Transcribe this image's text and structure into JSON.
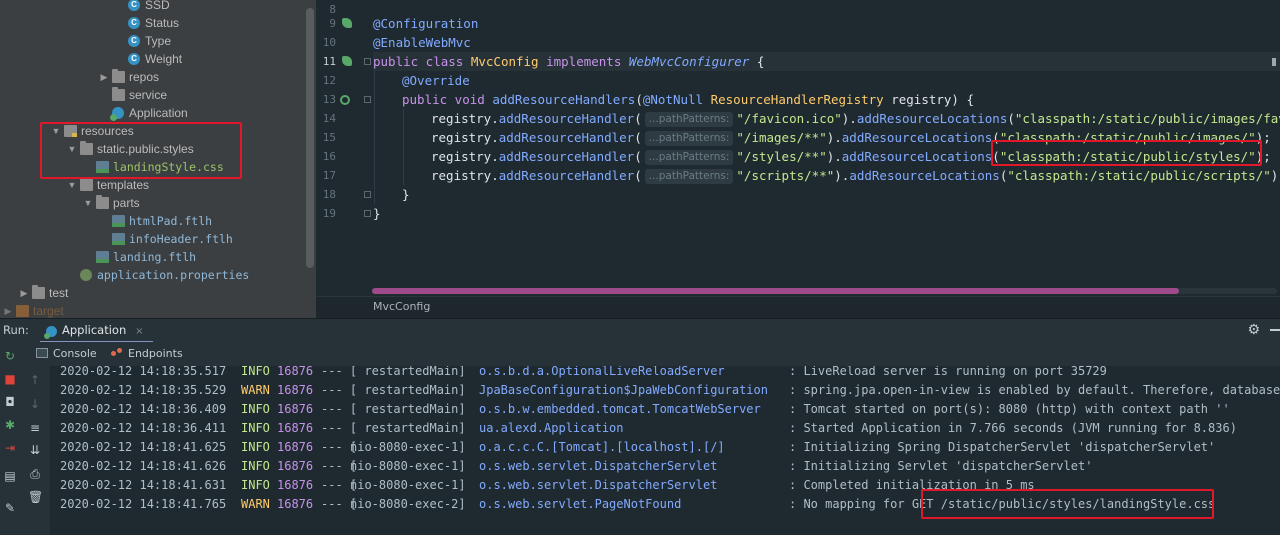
{
  "tree": {
    "items": [
      {
        "label": "SSD",
        "icon": "class-icon",
        "depth": 7,
        "arrow": ""
      },
      {
        "label": "Status",
        "icon": "class-icon",
        "depth": 7,
        "arrow": ""
      },
      {
        "label": "Type",
        "icon": "class-icon",
        "depth": 7,
        "arrow": ""
      },
      {
        "label": "Weight",
        "icon": "class-icon",
        "depth": 7,
        "arrow": ""
      },
      {
        "label": "repos",
        "icon": "folder-icon",
        "depth": 6,
        "arrow": "right"
      },
      {
        "label": "service",
        "icon": "folder-icon",
        "depth": 6,
        "arrow": ""
      },
      {
        "label": "Application",
        "icon": "spring-app-icon",
        "depth": 6,
        "arrow": ""
      },
      {
        "label": "resources",
        "icon": "resources-folder-icon",
        "depth": 3,
        "arrow": "down"
      },
      {
        "label": "static.public.styles",
        "icon": "folder-icon",
        "depth": 4,
        "arrow": "down"
      },
      {
        "label": "landingStyle.css",
        "icon": "css-file-icon",
        "depth": 5,
        "arrow": "",
        "file": true
      },
      {
        "label": "templates",
        "icon": "folder-icon",
        "depth": 4,
        "arrow": "down"
      },
      {
        "label": "parts",
        "icon": "folder-icon",
        "depth": 5,
        "arrow": "down"
      },
      {
        "label": "htmlPad.ftlh",
        "icon": "ftl-file-icon",
        "depth": 6,
        "arrow": "",
        "file": true
      },
      {
        "label": "infoHeader.ftlh",
        "icon": "ftl-file-icon",
        "depth": 6,
        "arrow": "",
        "file": true
      },
      {
        "label": "landing.ftlh",
        "icon": "ftl-file-icon",
        "depth": 5,
        "arrow": "",
        "file": true
      },
      {
        "label": "application.properties",
        "icon": "properties-file-icon",
        "depth": 4,
        "arrow": "",
        "file": true
      },
      {
        "label": "test",
        "icon": "folder-icon",
        "depth": 1,
        "arrow": "right"
      },
      {
        "label": "target",
        "icon": "target-folder-icon",
        "depth": 0,
        "arrow": "right",
        "muted": true
      }
    ]
  },
  "editor": {
    "line_numbers": [
      "8",
      "9",
      "10",
      "11",
      "12",
      "13",
      "14",
      "15",
      "16",
      "17",
      "18",
      "19"
    ],
    "current_line": "11",
    "code": {
      "l9_annotation": "@Configuration",
      "l10_annotation": "@EnableWebMvc",
      "l11_kw1": "public class ",
      "l11_class": "MvcConfig",
      "l11_kw2": " implements ",
      "l11_iface": "WebMvcConfigurer",
      "l11_brace": " {",
      "l12_annotation": "@Override",
      "l13_kw": "public void ",
      "l13_method": "addResourceHandlers",
      "l13_paren": "(",
      "l13_ann": "@NotNull",
      "l13_type": " ResourceHandlerRegistry",
      "l13_param": " registry) {",
      "registry": "registry.",
      "add_handler": "addResourceHandler",
      "add_locations": "addResourceLocations",
      "hint": "...pathPatterns:",
      "l14_pattern": "\"/favicon.ico\"",
      "l14_location": "\"classpath:/static/public/images/favi",
      "l15_pattern": "\"/images/**\"",
      "l15_location": "\"classpath:/static/public/images/\"",
      "l16_pattern": "\"/styles/**\"",
      "l16_location": "\"classpath:/static/public/styles/\"",
      "l17_pattern": "\"/scripts/**\"",
      "l17_location": "\"classpath:/static/public/scripts/\"",
      "close_paren": ").",
      "paren_open": "(",
      "end_stmt": ");",
      "l18_brace": "}",
      "l19_brace": "}"
    },
    "breadcrumb": "MvcConfig"
  },
  "run": {
    "label": "Run:",
    "tab": "Application",
    "tab_close": "×",
    "subtabs": {
      "console": "Console",
      "endpoints": "Endpoints"
    },
    "logs": [
      {
        "ts": "2020-02-12 14:18:35.517",
        "level": "INFO",
        "pid": "16876",
        "sep": "--- [",
        "thread": "  restartedMain]",
        "logger": "o.s.b.d.a.OptionalLiveReloadServer",
        "msg": ": LiveReload server is running on port 35729"
      },
      {
        "ts": "2020-02-12 14:18:35.529",
        "level": "WARN",
        "pid": "16876",
        "sep": "--- [",
        "thread": "  restartedMain]",
        "logger": "JpaBaseConfiguration$JpaWebConfiguration",
        "msg": ": spring.jpa.open-in-view is enabled by default. Therefore, database q"
      },
      {
        "ts": "2020-02-12 14:18:36.409",
        "level": "INFO",
        "pid": "16876",
        "sep": "--- [",
        "thread": "  restartedMain]",
        "logger": "o.s.b.w.embedded.tomcat.TomcatWebServer",
        "msg": ": Tomcat started on port(s): 8080 (http) with context path ''"
      },
      {
        "ts": "2020-02-12 14:18:36.411",
        "level": "INFO",
        "pid": "16876",
        "sep": "--- [",
        "thread": "  restartedMain]",
        "logger": "ua.alexd.Application",
        "msg": ": Started Application in 7.766 seconds (JVM running for 8.836)"
      },
      {
        "ts": "2020-02-12 14:18:41.625",
        "level": "INFO",
        "pid": "16876",
        "sep": "--- [",
        "thread": "nio-8080-exec-1]",
        "logger": "o.a.c.c.C.[Tomcat].[localhost].[/]",
        "msg": ": Initializing Spring DispatcherServlet 'dispatcherServlet'"
      },
      {
        "ts": "2020-02-12 14:18:41.626",
        "level": "INFO",
        "pid": "16876",
        "sep": "--- [",
        "thread": "nio-8080-exec-1]",
        "logger": "o.s.web.servlet.DispatcherServlet",
        "msg": ": Initializing Servlet 'dispatcherServlet'"
      },
      {
        "ts": "2020-02-12 14:18:41.631",
        "level": "INFO",
        "pid": "16876",
        "sep": "--- [",
        "thread": "nio-8080-exec-1]",
        "logger": "o.s.web.servlet.DispatcherServlet",
        "msg": ": Completed initialization in 5 ms"
      },
      {
        "ts": "2020-02-12 14:18:41.765",
        "level": "WARN",
        "pid": "16876",
        "sep": "--- [",
        "thread": "nio-8080-exec-2]",
        "logger": "o.s.web.servlet.PageNotFound",
        "msg": ": No mapping for GET /static/public/styles/landingStyle.css"
      }
    ]
  },
  "colors": {
    "highlight_box": "#e0182a",
    "editor_bg": "#1f2a30",
    "tree_bg": "#3c3f41",
    "info": "#c3e88d",
    "warn": "#ffcb6b"
  }
}
